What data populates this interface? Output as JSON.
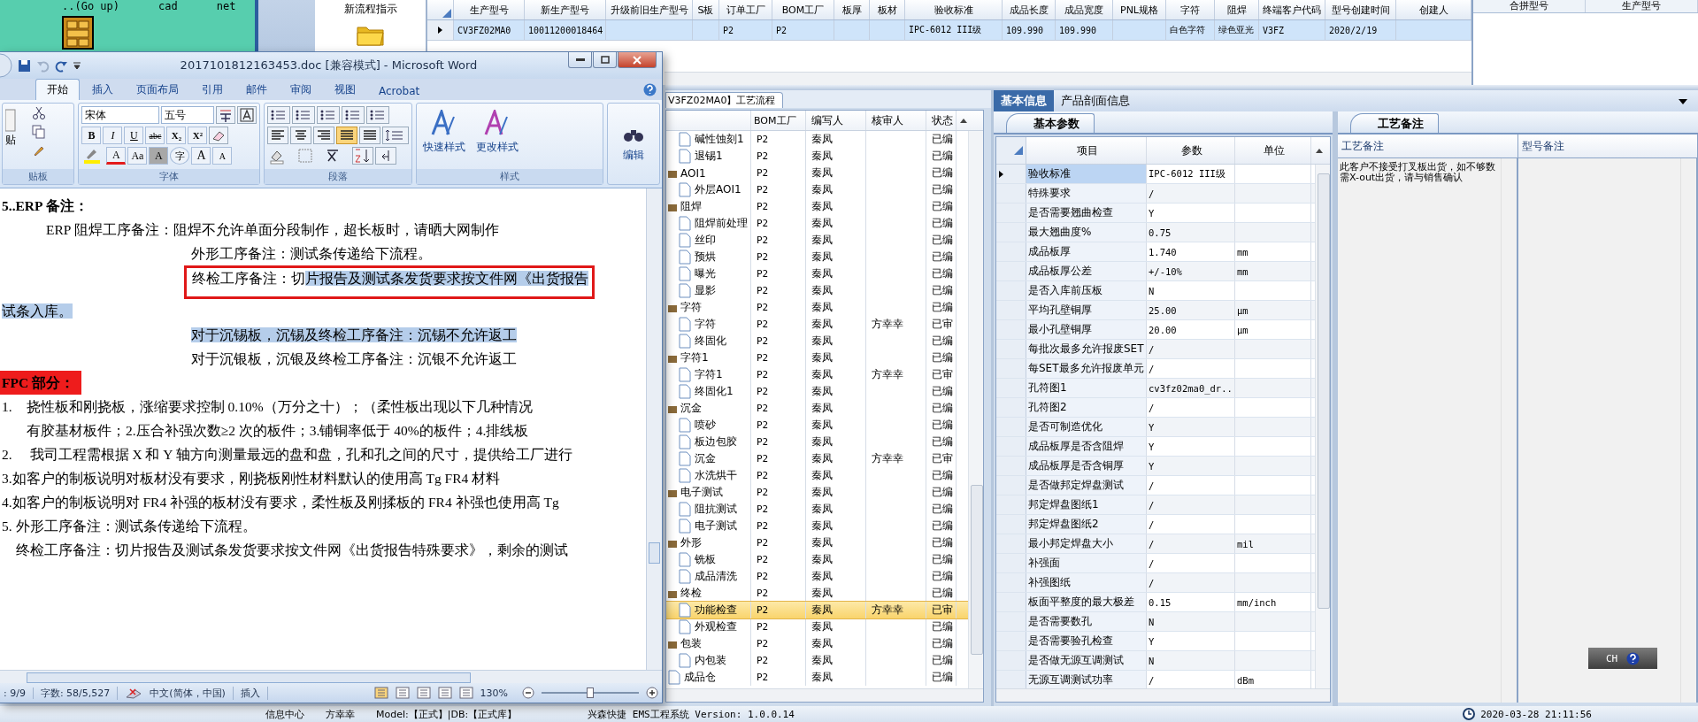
{
  "file_browser": {
    "items": [
      "..(Go up)",
      "cad",
      "net"
    ]
  },
  "sidebar": {
    "items": [
      {
        "label": "新流程指示"
      }
    ]
  },
  "model_table": {
    "columns": [
      "生产型号",
      "新生产型号",
      "升级前旧生产型号",
      "S板",
      "订单工厂",
      "BOM工厂",
      "板厚",
      "板材",
      "验收标准",
      "成品长度",
      "成品宽度",
      "PNL规格",
      "字符",
      "阻焊",
      "终端客户代码",
      "型号创建时间",
      "创建人"
    ],
    "rows": [
      {
        "selected": true,
        "cells": [
          "CV3FZ02MA0",
          "10011200018464",
          null,
          null,
          "P2",
          "P2",
          null,
          null,
          "IPC-6012 III级",
          "109.990",
          "109.990",
          null,
          "白色字符",
          "绿色亚光",
          "V3FZ",
          "2020/2/19",
          null
        ]
      }
    ]
  },
  "merge_table": {
    "columns": [
      "合拼型号",
      "生产型号"
    ]
  },
  "process_flow": {
    "tab": "V3FZ02MA0】工艺流程",
    "columns": [
      "BOM工厂",
      "编写人",
      "核审人",
      "状态"
    ],
    "tree": [
      {
        "children": [
          {
            "name": "碱性蚀刻1",
            "bom": "P2",
            "writer": "秦凤",
            "status": "已编",
            "selected": false
          },
          {
            "name": "退锡1",
            "bom": "P2",
            "writer": "秦凤",
            "status": "已编",
            "selected": false
          }
        ]
      },
      {
        "name": "AOI1",
        "bom": "P2",
        "writer": "秦凤",
        "status": "已编",
        "selected": false,
        "children": [
          {
            "name": "外层AOI1",
            "bom": "P2",
            "writer": "秦凤",
            "status": "已编",
            "selected": false
          }
        ]
      },
      {
        "name": "阻焊",
        "bom": "P2",
        "writer": "秦凤",
        "status": "已编",
        "selected": false,
        "children": [
          {
            "name": "阻焊前处理",
            "bom": "P2",
            "writer": "秦凤",
            "status": "已编",
            "selected": false
          },
          {
            "name": "丝印",
            "bom": "P2",
            "writer": "秦凤",
            "status": "已编",
            "selected": false
          },
          {
            "name": "预烘",
            "bom": "P2",
            "writer": "秦凤",
            "status": "已编",
            "selected": false
          },
          {
            "name": "曝光",
            "bom": "P2",
            "writer": "秦凤",
            "status": "已编",
            "selected": false
          },
          {
            "name": "显影",
            "bom": "P2",
            "writer": "秦凤",
            "status": "已编",
            "selected": false
          }
        ]
      },
      {
        "name": "字符",
        "bom": "P2",
        "writer": "秦凤",
        "status": "已编",
        "selected": false,
        "children": [
          {
            "name": "字符",
            "bom": "P2",
            "writer": "秦凤",
            "reviewer": "方幸幸",
            "status": "已审",
            "selected": false
          },
          {
            "name": "终固化",
            "bom": "P2",
            "writer": "秦凤",
            "status": "已编",
            "selected": false
          }
        ]
      },
      {
        "name": "字符1",
        "bom": "P2",
        "writer": "秦凤",
        "status": "已编",
        "selected": false,
        "children": [
          {
            "name": "字符1",
            "bom": "P2",
            "writer": "秦凤",
            "reviewer": "方幸幸",
            "status": "已审",
            "selected": false
          },
          {
            "name": "终固化1",
            "bom": "P2",
            "writer": "秦凤",
            "status": "已编",
            "selected": false
          }
        ]
      },
      {
        "name": "沉金",
        "bom": "P2",
        "writer": "秦凤",
        "status": "已编",
        "selected": false,
        "children": [
          {
            "name": "喷砂",
            "bom": "P2",
            "writer": "秦凤",
            "status": "已编",
            "selected": false
          },
          {
            "name": "板边包胶",
            "bom": "P2",
            "writer": "秦凤",
            "status": "已编",
            "selected": false
          },
          {
            "name": "沉金",
            "bom": "P2",
            "writer": "秦凤",
            "reviewer": "方幸幸",
            "status": "已审",
            "selected": false
          },
          {
            "name": "水洗烘干",
            "bom": "P2",
            "writer": "秦凤",
            "status": "已编",
            "selected": false
          }
        ]
      },
      {
        "name": "电子测试",
        "bom": "P2",
        "writer": "秦凤",
        "status": "已编",
        "selected": false,
        "children": [
          {
            "name": "阻抗测试",
            "bom": "P2",
            "writer": "秦凤",
            "status": "已编",
            "selected": false
          },
          {
            "name": "电子测试",
            "bom": "P2",
            "writer": "秦凤",
            "status": "已编",
            "selected": false
          }
        ]
      },
      {
        "name": "外形",
        "bom": "P2",
        "writer": "秦凤",
        "status": "已编",
        "selected": false,
        "children": [
          {
            "name": "铣板",
            "bom": "P2",
            "writer": "秦凤",
            "status": "已编",
            "selected": false
          },
          {
            "name": "成品清洗",
            "bom": "P2",
            "writer": "秦凤",
            "status": "已编",
            "selected": false
          }
        ]
      },
      {
        "name": "终检",
        "bom": "P2",
        "writer": "秦凤",
        "status": "已编",
        "selected": false,
        "children": [
          {
            "name": "功能检查",
            "bom": "P2",
            "writer": "秦凤",
            "reviewer": "方幸幸",
            "status": "已审",
            "selected": true
          },
          {
            "name": "外观检查",
            "bom": "P2",
            "writer": "秦凤",
            "status": "已编",
            "selected": false
          }
        ]
      },
      {
        "name": "包装",
        "bom": "P2",
        "writer": "秦凤",
        "status": "已编",
        "selected": false,
        "children": [
          {
            "name": "内包装",
            "bom": "P2",
            "writer": "秦凤",
            "status": "已编",
            "selected": false
          }
        ]
      },
      {
        "name": "成品仓",
        "bom": "P2",
        "writer": "秦凤",
        "status": "已编",
        "selected": false
      }
    ]
  },
  "info_panel": {
    "tabs": [
      {
        "label": "基本信息",
        "selected": true
      },
      {
        "label": "产品剖面信息",
        "selected": false
      }
    ],
    "subtab": "基本参数",
    "columns": [
      "项目",
      "参数",
      "单位"
    ],
    "rows": [
      {
        "item": "验收标准",
        "value": "IPC-6012 III级",
        "selected": true
      },
      {
        "item": "特殊要求",
        "value": "/",
        "selected": false
      },
      {
        "item": "是否需要翘曲检查",
        "value": "Y",
        "selected": false
      },
      {
        "item": "最大翘曲度%",
        "value": "0.75",
        "selected": false
      },
      {
        "item": "成品板厚",
        "value": "1.740",
        "unit": "mm",
        "selected": false
      },
      {
        "item": "成品板厚公差",
        "value": "+/-10%",
        "unit": "mm",
        "selected": false
      },
      {
        "item": "是否入库前压板",
        "value": "N",
        "selected": false
      },
      {
        "item": "平均孔壁铜厚",
        "value": "25.00",
        "unit": "μm",
        "selected": false
      },
      {
        "item": "最小孔壁铜厚",
        "value": "20.00",
        "unit": "μm",
        "selected": false
      },
      {
        "item": "每批次最多允许报废SET",
        "value": "/",
        "selected": false
      },
      {
        "item": "每SET最多允许报废单元",
        "value": "/",
        "selected": false
      },
      {
        "item": "孔符图1",
        "value": "cv3fz02ma0_dr...",
        "selected": false
      },
      {
        "item": "孔符图2",
        "value": "/",
        "selected": false
      },
      {
        "item": "是否可制造优化",
        "value": "Y",
        "selected": false
      },
      {
        "item": "成品板厚是否含阻焊",
        "value": "Y",
        "selected": false
      },
      {
        "item": "成品板厚是否含铜厚",
        "value": "Y",
        "selected": false
      },
      {
        "item": "是否做邦定焊盘测试",
        "value": "/",
        "selected": false
      },
      {
        "item": "邦定焊盘图纸1",
        "value": "/",
        "selected": false
      },
      {
        "item": "邦定焊盘图纸2",
        "value": "/",
        "selected": false
      },
      {
        "item": "最小邦定焊盘大小",
        "value": "/",
        "unit": "mil",
        "selected": false
      },
      {
        "item": "补强面",
        "value": "/",
        "selected": false
      },
      {
        "item": "补强图纸",
        "value": "/",
        "selected": false
      },
      {
        "item": "板面平整度的最大极差",
        "value": "0.15",
        "unit": "mm/inch",
        "selected": false
      },
      {
        "item": "是否需要数孔",
        "value": "N",
        "selected": false
      },
      {
        "item": "是否需要验孔检查",
        "value": "Y",
        "selected": false
      },
      {
        "item": "是否做无源互调测试",
        "value": "N",
        "selected": false
      },
      {
        "item": "无源互调测试功率",
        "value": "/",
        "unit": "dBm",
        "selected": false
      }
    ]
  },
  "notes_panel": {
    "tab": "工艺备注",
    "columns": [
      "工艺备注",
      "型号备注"
    ],
    "process_note": "此客户不接受打叉板出货，如不够数需X-out出货，请与销售确认"
  },
  "language_bar": {
    "label": "CH"
  },
  "status_bar": {
    "items": [
      "信息中心",
      "方幸幸",
      "Model:【正式】|DB:【正式库】"
    ],
    "version": "兴森快捷 EMS工程系统 Version: 1.0.0.14",
    "datetime": "2020-03-28 21:11:56"
  },
  "word_window": {
    "title": "2017101812163453.doc [兼容模式] - Microsoft Word",
    "tabs": [
      {
        "label": "开始",
        "selected": true
      },
      {
        "label": "插入",
        "selected": false
      },
      {
        "label": "页面布局",
        "selected": false
      },
      {
        "label": "引用",
        "selected": false
      },
      {
        "label": "邮件",
        "selected": false
      },
      {
        "label": "审阅",
        "selected": false
      },
      {
        "label": "视图",
        "selected": false
      },
      {
        "label": "Acrobat",
        "selected": false
      }
    ],
    "paste_label": "贴",
    "clipboard_group": "贴板",
    "font": "宋体",
    "font_size": "五号",
    "font_buttons": [
      "B",
      "I",
      "U",
      "abc",
      "X₂",
      "X²"
    ],
    "font_buttons_2": [
      "A",
      "Aa",
      "A",
      "字",
      "A",
      "A"
    ],
    "alignment": [
      {
        "selected": false
      },
      {
        "selected": false
      },
      {
        "selected": false
      },
      {
        "selected": true
      },
      {
        "selected": false
      }
    ],
    "groups": [
      "字体",
      "段落",
      "样式"
    ],
    "style_buttons": [
      "快速样式",
      "更改样式"
    ],
    "edit_button": "编辑",
    "lines": [
      {
        "kind": "heading",
        "segments": [
          {
            "text": "5..ERP 备注：",
            "selected": false
          }
        ]
      },
      {
        "kind": "note",
        "segments": [
          {
            "text": "ERP 阻焊工序备注：阻焊不允许单面分段制作，超长板时，请晒大网制作",
            "selected": false
          }
        ]
      },
      {
        "kind": "sub",
        "segments": [
          {
            "text": "外形工序备注：测试条传递给下流程。",
            "selected": false
          }
        ]
      },
      {
        "kind": "sub",
        "boxed": true,
        "segments": [
          {
            "text": "终检工序备注：切",
            "selected": false
          },
          {
            "text": "片报告及测试条发货要求按文件网《出货报告",
            "selected": true
          }
        ]
      },
      {
        "kind": "plain",
        "segments": [
          {
            "text": "试条入库。",
            "selected": true
          }
        ]
      },
      {
        "kind": "sub",
        "segments": [
          {
            "text": "对于沉锡板，沉锡及终检工序备注：沉锡不允许返工",
            "selected": true
          }
        ]
      },
      {
        "kind": "sub",
        "segments": [
          {
            "text": "对于沉银板，沉银及终检工序备注：沉银不允许返工",
            "selected": false
          }
        ]
      },
      {
        "kind": "section",
        "segments": [
          {
            "text": "FPC 部分：",
            "selected": false
          }
        ]
      },
      {
        "kind": "plain",
        "segments": [
          {
            "text": "1.　挠性板和刚挠板，涨缩要求控制 0.10%（万分之十）；（柔性板出现以下几种情况",
            "selected": false
          }
        ]
      },
      {
        "kind": "wrap",
        "segments": [
          {
            "text": "有胶基材板件；2.压合补强次数≥2 次的板件；3.铺铜率低于 40%的板件；4.排线板",
            "selected": false
          }
        ]
      },
      {
        "kind": "plain",
        "segments": [
          {
            "text": "2.　 我司工程需根据 X 和 Y 轴方向测量最远的盘和盘，孔和孔之间的尺寸，提供给工厂进行",
            "selected": false
          }
        ]
      },
      {
        "kind": "plain",
        "segments": [
          {
            "text": "3.如客户的制板说明对板材没有要求，刚挠板刚性材料默认的使用高 Tg FR4 材料",
            "selected": false
          }
        ]
      },
      {
        "kind": "plain",
        "segments": [
          {
            "text": "4.如客户的制板说明对 FR4 补强的板材没有要求，柔性板及刚揉板的 FR4 补强也使用高 Tg",
            "selected": false
          }
        ]
      },
      {
        "kind": "plain",
        "segments": [
          {
            "text": "5. 外形工序备注：测试条传递给下流程。",
            "selected": false
          }
        ]
      },
      {
        "kind": "indent",
        "segments": [
          {
            "text": "终检工序备注：切片报告及测试条发货要求按文件网《出货报告特殊要求》，剩余的测试",
            "selected": false
          }
        ]
      }
    ],
    "status": {
      "page": ": 9/9",
      "words": "字数: 58/5,527",
      "language": "中文(简体，中国)",
      "mode": "插入"
    },
    "zoom": {
      "label": "130%",
      "level": 0.5
    }
  }
}
